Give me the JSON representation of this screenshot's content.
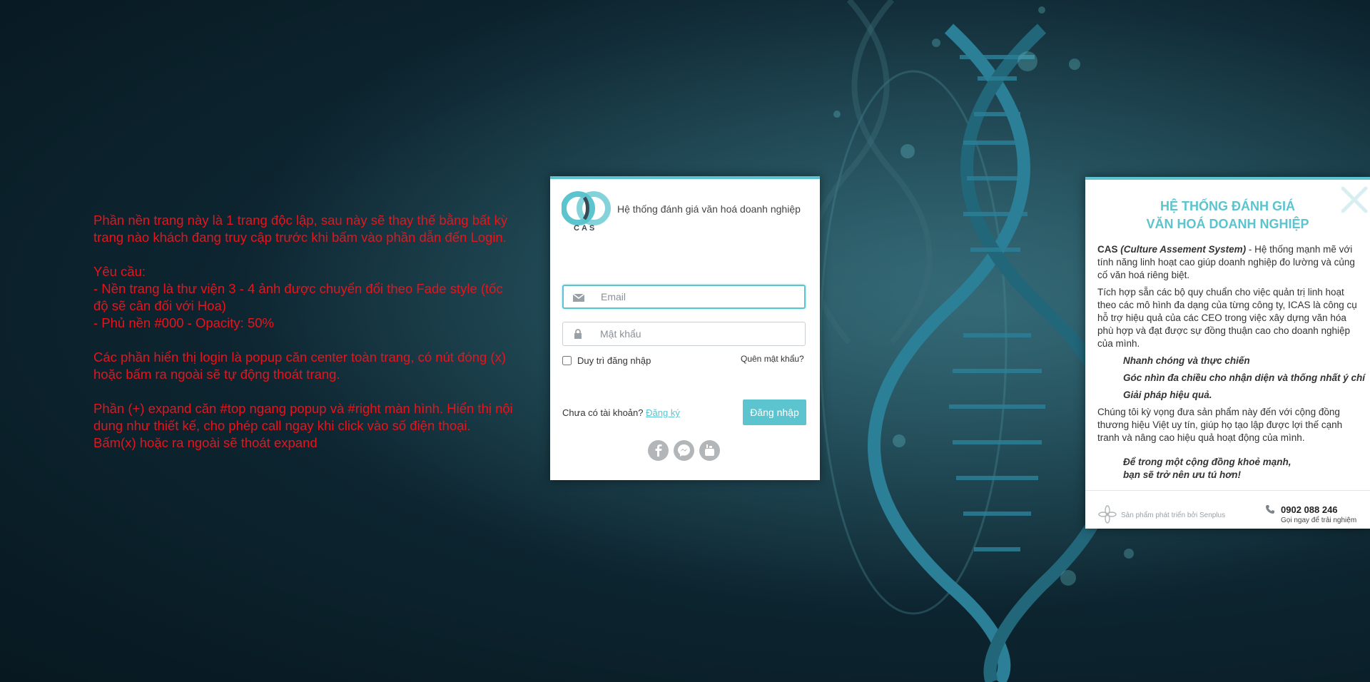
{
  "background": {
    "base_color": "#0d2530",
    "helix_color": "#2b7f97",
    "overlay_color": "#000",
    "overlay_opacity": "50%"
  },
  "note": {
    "color": "#e8141c",
    "paragraphs": [
      "Phần nền trang này là 1 trang độc lập, sau này sẽ thay thế bằng bất kỳ trang nào khách đang truy cập trước khi bấm vào phần dẫn đến Login.",
      "Yêu cầu:\n- Nền trang là thư viện 3 - 4 ảnh được chuyển đổi theo Fade style (tốc độ sẽ cân đối với Hoa)\n- Phủ nền #000 - Opacity: 50%",
      "Các phần hiển thị login là popup căn center toàn trang, có nút đóng (x) hoặc bấm ra ngoài sẽ tự động thoát trang.",
      "Phần (+) expand căn #top ngang popup và #right màn hình. Hiển thị nội dung như thiết kế, cho phép call ngay khi click vào số điện thoại. Bấm(x) hoặc ra ngoài sẽ thoát expand"
    ]
  },
  "login": {
    "accent": "#5bc4cf",
    "logo_text": "CAS",
    "title": "Hệ thống đánh giá văn hoá doanh nghiệp",
    "email_placeholder": "Email",
    "password_placeholder": "Mật khẩu",
    "remember_label": "Duy trì đăng nhập",
    "forgot_label": "Quên mật khẩu?",
    "no_account_label": "Chưa có tài khoản?",
    "register_label": "Đăng ký",
    "submit_label": "Đăng nhập",
    "social_icons": [
      "facebook-icon",
      "messenger-icon",
      "youtube-icon"
    ]
  },
  "info": {
    "title_line1": "HỆ THỐNG ĐÁNH GIÁ",
    "title_line2": "VĂN HOÁ DOANH NGHIỆP",
    "intro_brand": "CAS",
    "intro_brand_full": "(Culture Assement System)",
    "intro_text": " - Hệ thống mạnh mẽ với tính năng linh hoạt cao giúp doanh nghiệp đo lường và củng cố văn hoá riêng biệt.",
    "para2": "Tích hợp sẵn các bộ quy chuẩn cho việc quản trị linh hoạt theo các mô hình đa dạng của từng công ty, ICAS là công cụ hỗ trợ hiệu quả của các CEO trong việc xây dựng văn hóa phù hợp và đạt được sự đồng thuận cao cho doanh nghiệp của mình.",
    "features": [
      "Nhanh chóng và thực chiến",
      "Góc nhìn đa chiều cho nhận diện và thống nhất ý chí",
      "Giải pháp hiệu quả."
    ],
    "para3": "Chúng tôi kỳ vọng đưa sản phẩm này đến với cộng đồng thương hiệu Việt uy tín, giúp họ tạo lập được lợi thế cạnh tranh và nâng cao hiệu quả hoạt động của mình.",
    "slogan_line1": "Để trong một cộng đồng khoẻ mạnh,",
    "slogan_line2": "bạn sẽ trở nên ưu tú hơn!",
    "credit": "Sản phẩm phát triển bởi Senplus",
    "phone": "0902 088 246",
    "phone_sub": "Gọi ngay để trải nghiệm"
  }
}
